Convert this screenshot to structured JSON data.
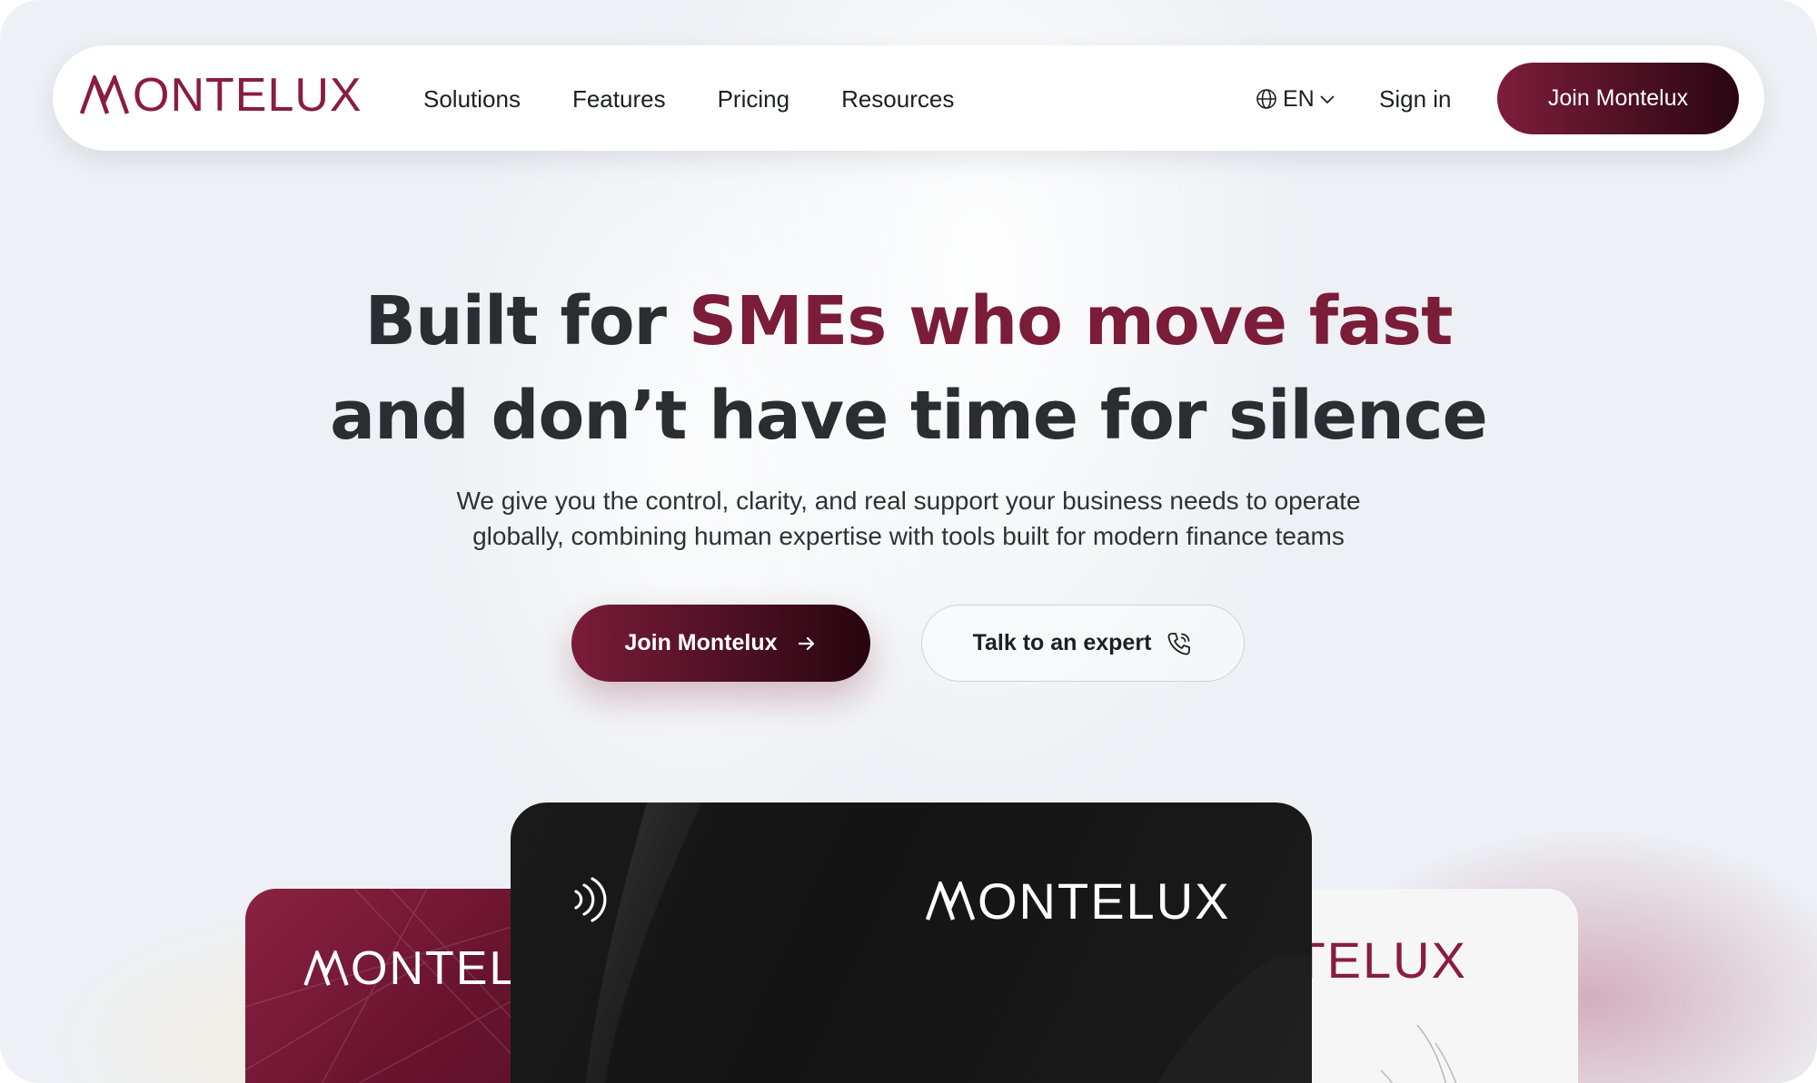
{
  "brand": {
    "name": "MONTELUX",
    "name_rest": "ONTELUX",
    "accent_color": "#7b1c39"
  },
  "nav": {
    "links": [
      "Solutions",
      "Features",
      "Pricing",
      "Resources"
    ],
    "language": "EN",
    "sign_in": "Sign in",
    "join": "Join Montelux"
  },
  "hero": {
    "headline_line1_plain": "Built for ",
    "headline_line1_accent": "SMEs who move fast",
    "headline_line2": "and don’t have time for silence",
    "subtitle_line1": "We give you the control, clarity, and real support your business needs to operate",
    "subtitle_line2": "globally, combining human expertise with tools built for modern finance teams",
    "cta_primary": "Join Montelux",
    "cta_secondary": "Talk to an expert"
  },
  "cards": {
    "red_logo": "ONTEL",
    "black_logo": "ONTELUX",
    "white_logo": "NTELUX"
  },
  "icons": {
    "language": "globe-icon",
    "dropdown": "chevron-down-icon",
    "cta_primary": "arrow-right-icon",
    "cta_secondary": "phone-icon",
    "card": "contactless-icon"
  }
}
